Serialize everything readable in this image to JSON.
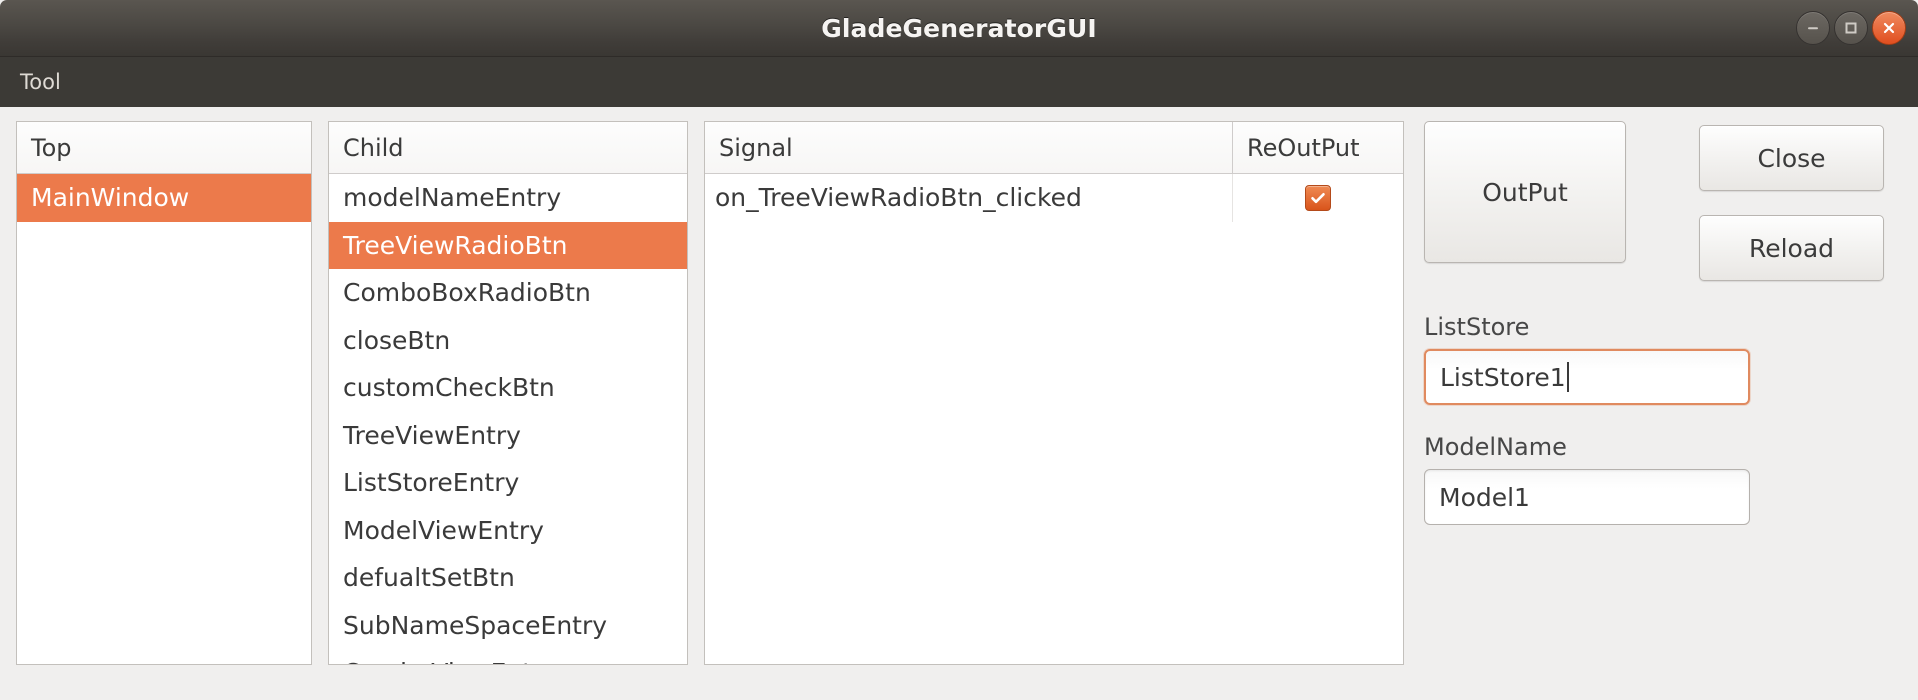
{
  "window": {
    "title": "GladeGeneratorGUI",
    "controls": [
      {
        "name": "minimize",
        "glyph": "–"
      },
      {
        "name": "maximize",
        "glyph": "□"
      },
      {
        "name": "close",
        "glyph": "✕"
      }
    ]
  },
  "menubar": {
    "items": [
      {
        "label": "Tool"
      }
    ]
  },
  "panels": {
    "top": {
      "header": "Top",
      "rows": [
        {
          "label": "MainWindow",
          "selected": true
        }
      ]
    },
    "child": {
      "header": "Child",
      "rows": [
        {
          "label": "modelNameEntry",
          "selected": false
        },
        {
          "label": "TreeViewRadioBtn",
          "selected": true
        },
        {
          "label": "ComboBoxRadioBtn",
          "selected": false
        },
        {
          "label": "closeBtn",
          "selected": false
        },
        {
          "label": "customCheckBtn",
          "selected": false
        },
        {
          "label": "TreeViewEntry",
          "selected": false
        },
        {
          "label": "ListStoreEntry",
          "selected": false
        },
        {
          "label": "ModelViewEntry",
          "selected": false
        },
        {
          "label": "defualtSetBtn",
          "selected": false
        },
        {
          "label": "SubNameSpaceEntry",
          "selected": false
        },
        {
          "label": "ComboViewEntry",
          "selected": false
        }
      ]
    },
    "signal": {
      "headers": {
        "signal": "Signal",
        "reoutput": "ReOutPut"
      },
      "rows": [
        {
          "signal": "on_TreeViewRadioBtn_clicked",
          "reoutput": true
        }
      ]
    }
  },
  "right": {
    "output_button": "OutPut",
    "close_button": "Close",
    "reload_button": "Reload",
    "liststore_label": "ListStore",
    "liststore_value": "ListStore1",
    "modelname_label": "ModelName",
    "modelname_value": "Model1"
  },
  "colors": {
    "selection_orange": "#ec7a4b",
    "checkbox_orange": "#d9541b",
    "focus_border": "#e08a5f",
    "titlebar_dark": "#3a3733",
    "menubar_dark": "#3c3a36",
    "page_background": "#f0efee"
  }
}
